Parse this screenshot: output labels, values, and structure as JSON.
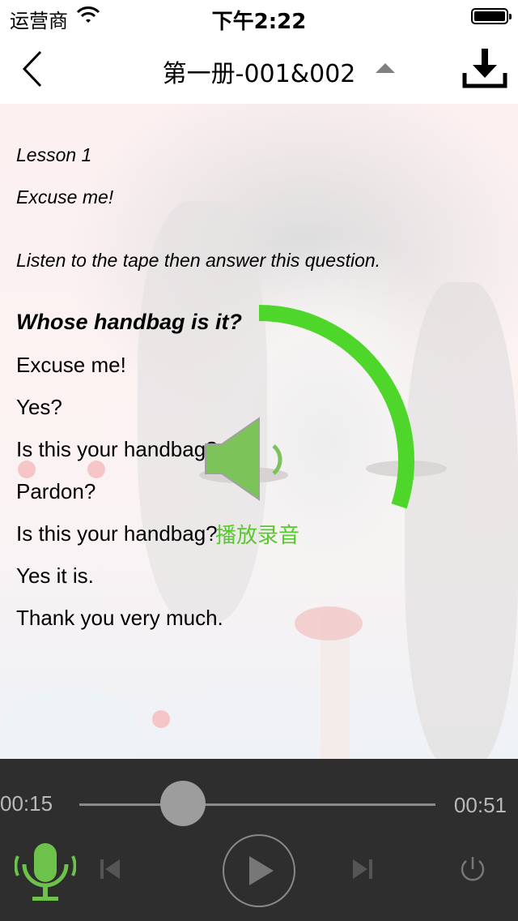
{
  "status_bar": {
    "carrier": "运营商",
    "time": "下午2:22"
  },
  "nav": {
    "title": "第一册-001&002"
  },
  "lesson": {
    "lesson_number": "Lesson 1",
    "lesson_title": "Excuse me!",
    "instruction": "Listen to the tape then answer this question.",
    "question": "Whose handbag is it?",
    "dialogue": [
      "Excuse me!",
      "Yes?",
      "Is this your handbag?",
      "Pardon?",
      "Is this your handbag?",
      "Yes it is.",
      "Thank you very much."
    ]
  },
  "overlay": {
    "label": "播放录音",
    "progress": 0.3,
    "color": "#4fd62a"
  },
  "player": {
    "current_time": "00:15",
    "total_time": "00:51",
    "progress": 0.29,
    "mic_color": "#6cc24a"
  }
}
